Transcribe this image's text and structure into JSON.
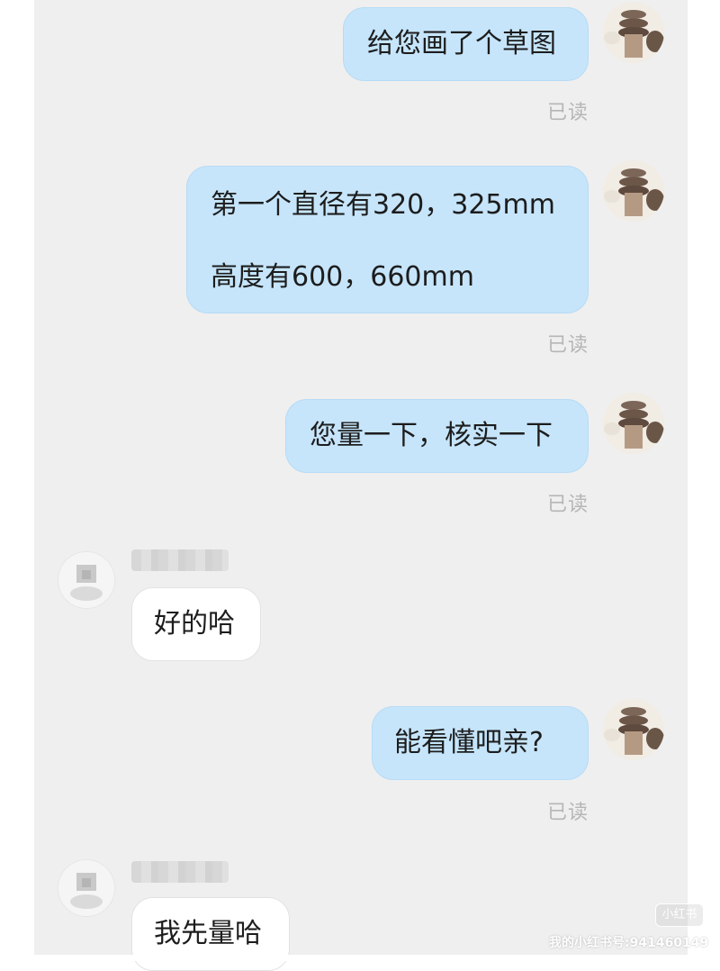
{
  "messages": [
    {
      "dir": "out",
      "lines": [
        "给您画了个草图"
      ],
      "read": "已读"
    },
    {
      "dir": "out",
      "lines": [
        "第一个直径有320，325mm",
        "高度有600，660mm"
      ],
      "read": "已读"
    },
    {
      "dir": "out",
      "lines": [
        "您量一下，核实一下"
      ],
      "read": "已读"
    },
    {
      "dir": "in",
      "lines": [
        "好的哈"
      ]
    },
    {
      "dir": "out",
      "lines": [
        "能看懂吧亲?"
      ],
      "read": "已读"
    },
    {
      "dir": "in",
      "lines": [
        "我先量哈"
      ]
    }
  ],
  "watermark": {
    "badge": "小红书",
    "text": "我的小红书号:941460149"
  },
  "colors": {
    "background": "#efefef",
    "outgoing_bubble": "#c6e5fb",
    "incoming_bubble": "#ffffff",
    "read_receipt": "#b6b6b6"
  },
  "icons": {
    "my_avatar": "pottery-planters-avatar",
    "contact_avatar": "blurred-avatar"
  }
}
